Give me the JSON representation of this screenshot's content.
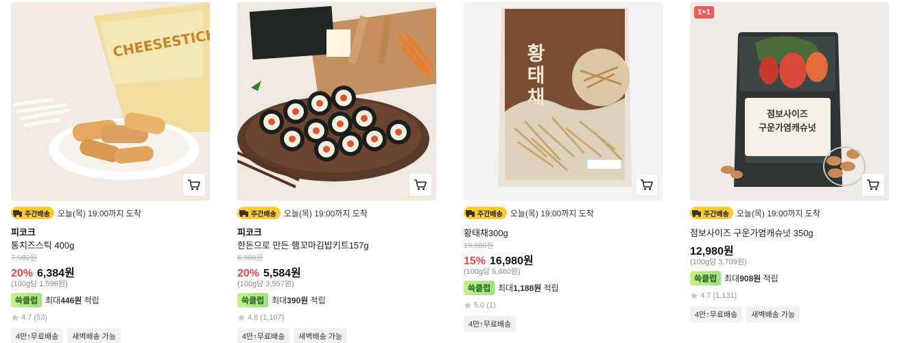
{
  "delivery_badge": "주간배송",
  "delivery_text": "오늘(목) 19:00까지 도착",
  "reward_badge": "쓱클럽",
  "reward_prefix": "최대",
  "reward_suffix": " 적립",
  "colors": {
    "discount": "#f04646",
    "delivery_badge_bg": "#ffcb2f",
    "reward_badge_bg": "#a8e47f",
    "promo_badge_bg": "#f05a5a"
  },
  "products": [
    {
      "brand": "피코크",
      "name": "통치즈스틱 400g",
      "original_price": "7,980원",
      "discount": "20%",
      "price": "6,384원",
      "unit_price": "(100g당 1,596원)",
      "reward_amount": "446원",
      "rating": "4.7",
      "review_count": "(53)",
      "tags": [
        "4만↑무료배송",
        "새벽배송 가능"
      ],
      "image_icon": "cheese-stick-product-image"
    },
    {
      "brand": "피코크",
      "name": "한돈으로 만든 햄꼬마김밥키트157g",
      "original_price": "6,980원",
      "discount": "20%",
      "price": "5,584원",
      "unit_price": "(100g당 3,557원)",
      "reward_amount": "390원",
      "rating": "4.6",
      "review_count": "(1,107)",
      "tags": [
        "4만↑무료배송",
        "새벽배송 가능"
      ],
      "image_icon": "kimbap-kit-product-image"
    },
    {
      "brand": "",
      "name": "황태채300g",
      "original_price": "19,980원",
      "discount": "15%",
      "price": "16,980원",
      "unit_price": "(100g당 5,660원)",
      "reward_amount": "1,188원",
      "rating": "5.0",
      "review_count": "(1)",
      "tags": [
        "4만↑무료배송"
      ],
      "image_icon": "dried-pollock-product-image",
      "package_text": "황태채"
    },
    {
      "brand": "",
      "name": "점보사이즈 구운가염캐슈넛 350g",
      "original_price": "",
      "discount": "",
      "price": "12,980원",
      "unit_price": "(100g당 3,709원)",
      "reward_amount": "908원",
      "rating": "4.7",
      "review_count": "(1,131)",
      "tags": [
        "4만↑무료배송",
        "새벽배송 가능"
      ],
      "image_icon": "cashew-nut-product-image",
      "promo_badge": "1+1",
      "package_text": "점보사이즈\n구운가염캐슈넛"
    }
  ]
}
